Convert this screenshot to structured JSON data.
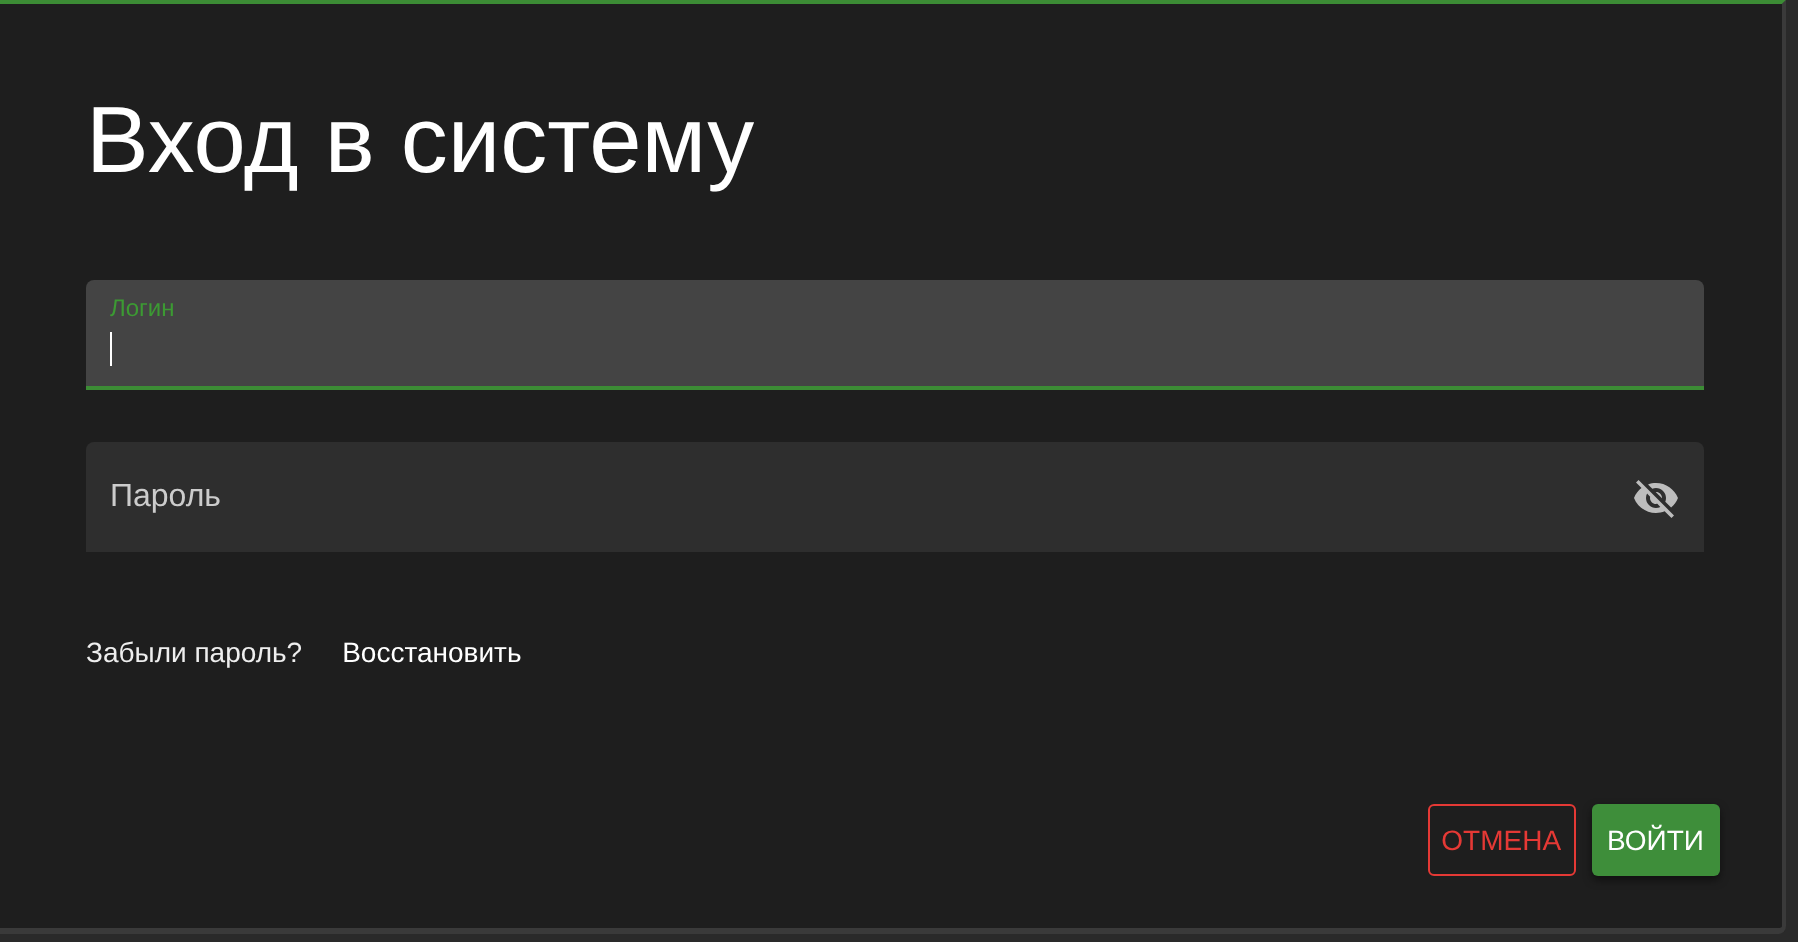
{
  "dialog": {
    "title": "Вход в систему"
  },
  "fields": [
    {
      "label": "Логин",
      "kind": "text",
      "focused": true
    },
    {
      "label": "Пароль",
      "kind": "password",
      "focused": false
    }
  ],
  "forgot": {
    "text": "Забыли пароль?",
    "link": "Восстановить"
  },
  "buttons": [
    {
      "label": "ОТМЕНА",
      "kind": "outlined"
    },
    {
      "label": "ВОЙТИ",
      "kind": "primary"
    }
  ]
}
